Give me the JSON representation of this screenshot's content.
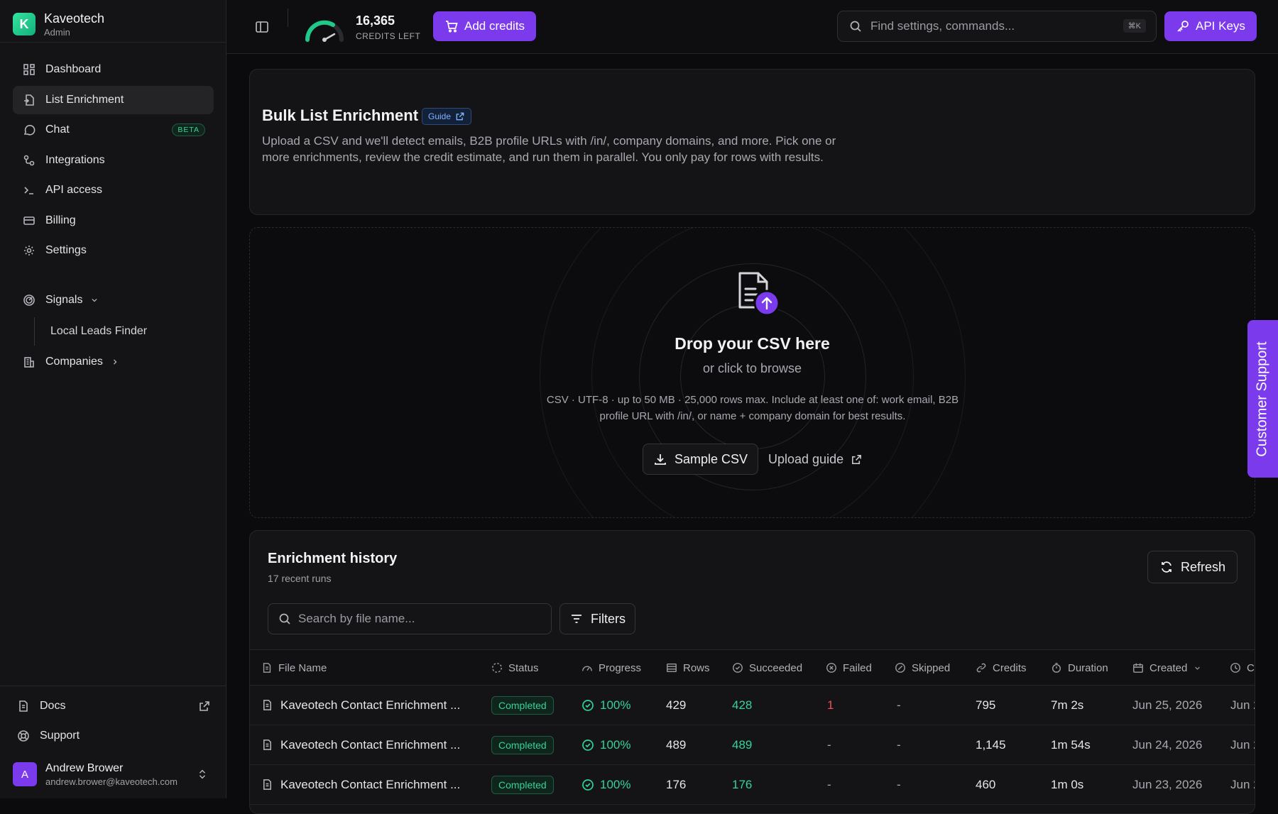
{
  "brand": {
    "initial": "K",
    "name": "Kaveotech",
    "role": "Admin"
  },
  "nav": [
    {
      "label": "Dashboard",
      "icon": "grid-icon"
    },
    {
      "label": "List Enrichment",
      "icon": "file-import-icon",
      "active": true
    },
    {
      "label": "Chat",
      "icon": "chat-bubble-icon",
      "badge": "BETA"
    },
    {
      "label": "Integrations",
      "icon": "integrations-icon"
    },
    {
      "label": "API access",
      "icon": "terminal-icon"
    },
    {
      "label": "Billing",
      "icon": "credit-card-icon"
    },
    {
      "label": "Settings",
      "icon": "gear-icon"
    }
  ],
  "signals": {
    "label": "Signals",
    "sub_item": "Local Leads Finder"
  },
  "companies": {
    "label": "Companies"
  },
  "bottom": {
    "docs": "Docs",
    "support": "Support"
  },
  "user": {
    "initial": "A",
    "name": "Andrew Brower",
    "email": "andrew.brower@kaveotech.com"
  },
  "topbar": {
    "credits_value": "16,365",
    "credits_label": "CREDITS LEFT",
    "add_credits": "Add credits",
    "search_placeholder": "Find settings, commands...",
    "shortcut": "⌘K",
    "api_keys": "API Keys"
  },
  "intro": {
    "title": "Bulk List Enrichment",
    "guide": "Guide",
    "description": "Upload a CSV and we'll detect emails, B2B profile URLs with /in/, company domains, and more. Pick one or more enrichments, review the credit estimate, and run them in parallel. You only pay for rows with results."
  },
  "dropzone": {
    "title": "Drop your CSV here",
    "subtitle": "or click to browse",
    "note": "CSV · UTF-8 · up to 50 MB · 25,000 rows max. Include at least one of: work email, B2B profile URL with /in/, or name + company domain for best results.",
    "sample_button": "Sample CSV",
    "upload_guide": "Upload guide"
  },
  "history": {
    "title": "Enrichment history",
    "subtitle": "17 recent runs",
    "refresh": "Refresh",
    "search_placeholder": "Search by file name...",
    "filters": "Filters",
    "columns": [
      "File Name",
      "Status",
      "Progress",
      "Rows",
      "Succeeded",
      "Failed",
      "Skipped",
      "Credits",
      "Duration",
      "Created",
      "C"
    ],
    "rows": [
      {
        "file": "Kaveotech Contact Enrichment ...",
        "status": "Completed",
        "progress": "100%",
        "rows": "429",
        "succeeded": "428",
        "failed": "1",
        "skipped": "-",
        "credits": "795",
        "duration": "7m 2s",
        "created": "Jun 25, 2026",
        "completed": "Jun 2"
      },
      {
        "file": "Kaveotech Contact Enrichment ...",
        "status": "Completed",
        "progress": "100%",
        "rows": "489",
        "succeeded": "489",
        "failed": "-",
        "skipped": "-",
        "credits": "1,145",
        "duration": "1m 54s",
        "created": "Jun 24, 2026",
        "completed": "Jun 2"
      },
      {
        "file": "Kaveotech Contact Enrichment ...",
        "status": "Completed",
        "progress": "100%",
        "rows": "176",
        "succeeded": "176",
        "failed": "-",
        "skipped": "-",
        "credits": "460",
        "duration": "1m 0s",
        "created": "Jun 23, 2026",
        "completed": "Jun 2"
      }
    ]
  },
  "support_tab": "Customer Support",
  "colors": {
    "accent": "#7c3aed",
    "success": "#34d399",
    "danger": "#f05252",
    "brand": "#1fc98a"
  }
}
